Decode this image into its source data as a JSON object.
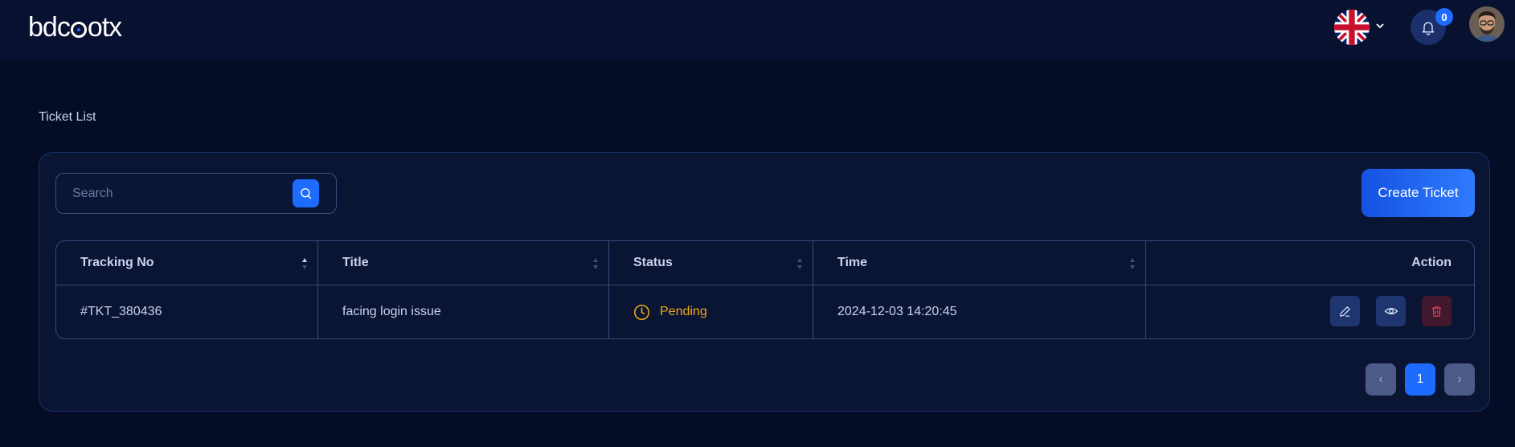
{
  "header": {
    "logo_text": "bdcbotx",
    "language_flag": "uk-flag-icon",
    "notification_count": "0",
    "avatar": "user-avatar"
  },
  "page": {
    "title": "Ticket List"
  },
  "search": {
    "placeholder": "Search"
  },
  "create_ticket_label": "Create Ticket",
  "table": {
    "columns": [
      "Tracking No",
      "Title",
      "Status",
      "Time",
      "Action"
    ],
    "rows": [
      {
        "tracking_no": "#TKT_380436",
        "title": "facing login issue",
        "status": "Pending",
        "time": "2024-12-03 14:20:45"
      }
    ]
  },
  "pagination": {
    "prev": "‹",
    "current": "1",
    "next": "›"
  },
  "colors": {
    "accent": "#1e6bff",
    "pending": "#f0a815",
    "background": "#050d26"
  }
}
